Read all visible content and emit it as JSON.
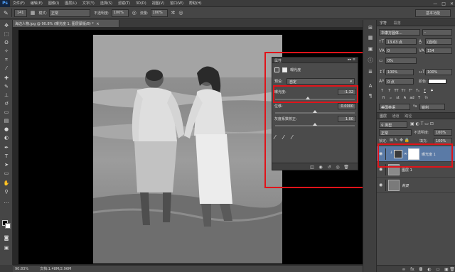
{
  "menubar": {
    "logo": "Ps",
    "items": [
      "文件(F)",
      "编辑(E)",
      "图像(I)",
      "图层(L)",
      "文字(Y)",
      "选择(S)",
      "滤镜(T)",
      "3D(D)",
      "视图(V)",
      "窗口(W)",
      "帮助(H)"
    ],
    "minimize": "—",
    "restore": "□",
    "close": "✕"
  },
  "options": {
    "brush_size": "141",
    "mode_label": "模式:",
    "mode_value": "正常",
    "opacity_label": "不透明度:",
    "opacity_value": "100%",
    "flow_label": "流量:",
    "flow_value": "100%",
    "workspace": "基本功能"
  },
  "document": {
    "tab_title": "海边人物.jpg @ 90.8% (曝光度 1, 图层蒙版/8) *",
    "tab_close": "×"
  },
  "status": {
    "zoom": "90.83%",
    "doc_size": "文档:1.48M/2.96M"
  },
  "properties": {
    "title": "属性",
    "panel_controls": "▸▸ ≡",
    "adjustment_name": "曝光度",
    "preset_label": "预设:",
    "preset_value": "自定",
    "exposure_label": "曝光度:",
    "exposure_value": "-1.32",
    "offset_label": "位移:",
    "offset_value": "0.0000",
    "gamma_label": "灰度系数校正:",
    "gamma_value": "1.00"
  },
  "character": {
    "tab_character": "字符",
    "tab_paragraph": "段落",
    "font_family": "华康方圆体...",
    "font_style": "-",
    "font_size": "13.63 点",
    "leading": "(自动)",
    "kerning": "0",
    "tracking": "154",
    "scale_percent": "0%",
    "vertical_scale": "100%",
    "horizontal_scale": "100%",
    "baseline_shift": "0 点",
    "color_label": "颜色:",
    "language": "美国英语",
    "antialias": "锐利"
  },
  "layers": {
    "tab_layers": "图层",
    "tab_channels": "通道",
    "tab_paths": "路径",
    "filter_kind": "类型",
    "blend_mode": "正常",
    "opacity_label": "不透明度:",
    "opacity_value": "100%",
    "lock_label": "锁定:",
    "fill_label": "填充:",
    "fill_value": "100%",
    "items": [
      {
        "name": "曝光度 1"
      },
      {
        "name": "图层 1"
      },
      {
        "name": "背景"
      }
    ]
  },
  "colors": {
    "highlight_red": "#e0141a",
    "selected_layer": "#5a7aa6"
  },
  "icons": {
    "brush": "brush-icon",
    "eye": "eye-icon",
    "lock": "lock-icon",
    "trash": "trash-icon"
  }
}
